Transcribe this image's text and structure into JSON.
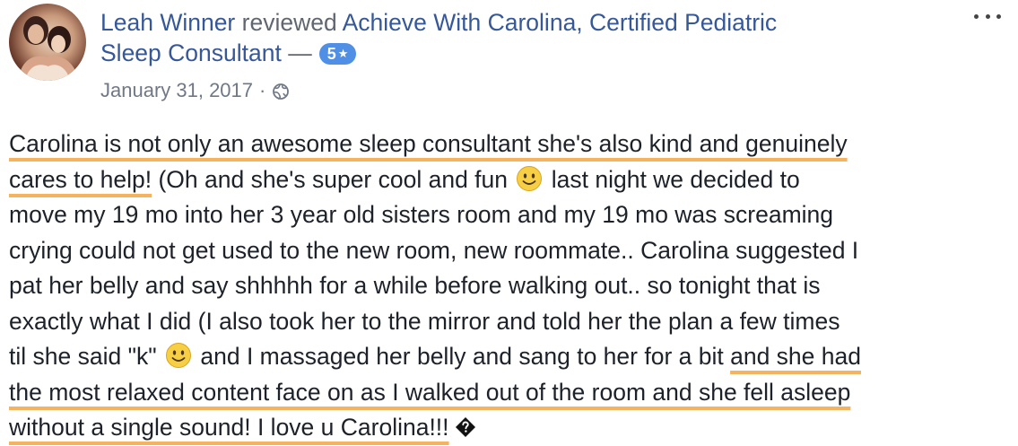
{
  "review": {
    "reviewer": "Leah Winner",
    "action": "reviewed",
    "page_name_1": "Achieve With Carolina, Certified Pediatric",
    "page_name_2": "Sleep Consultant",
    "dash": "—",
    "rating": "5",
    "rating_icon": "star-icon",
    "date": "January 31, 2017",
    "separator": "·",
    "privacy_icon": "globe-icon",
    "more_icon": "more-options-icon"
  },
  "body": {
    "l1": "Carolina is not only an awesome sleep consultant she's also kind and genuinely",
    "l2a": "cares to help!",
    "l2b": " (Oh and she's super cool and fun ",
    "l2c": " last night we decided to",
    "l3": "move my 19 mo into her 3 year old sisters room and my 19 mo was screaming",
    "l4": "crying could not get used to the new room, new roommate.. Carolina suggested I",
    "l5": "pat her belly and say shhhhh for a while before walking out.. so tonight that is",
    "l6": "exactly what I did (I also took her to the mirror and told her the plan a few times",
    "l7a": "til she said \"k\" ",
    "l7b": " and I massaged her belly and sang to her for a bit ",
    "l7c": "and she had",
    "l8": "the most relaxed content face on as I walked out of the room and she fell asleep",
    "l9": "without a single sound! I love u Carolina!!!",
    "emoji_1": "smiley-emoji",
    "emoji_2": "smiley-emoji",
    "emoji_3": "unrecognized-emoji"
  },
  "colors": {
    "link": "#365899",
    "highlight": "#f5b25f",
    "badge": "#4f8fe6",
    "text": "#1d2129",
    "meta": "#717885"
  }
}
